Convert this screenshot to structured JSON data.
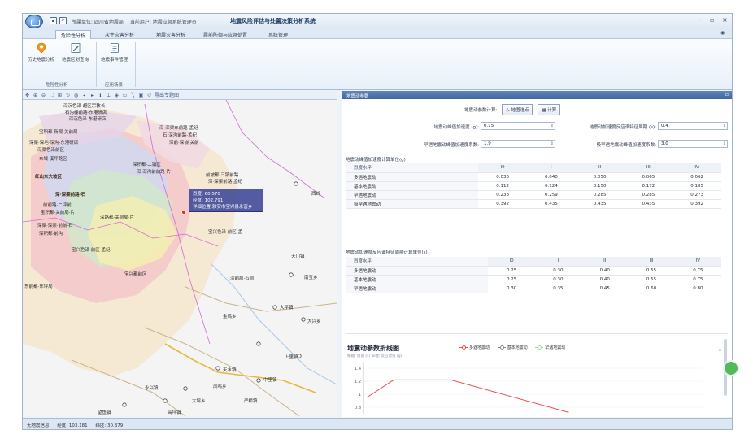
{
  "window": {
    "title_parts": [
      "所属单位: 四川省地震局",
      "当前用户: 地震应急系统管理员"
    ],
    "app_title": "地震风险评估与处置决策分析系统",
    "controls": [
      "–",
      "▫",
      "×"
    ]
  },
  "ribbon": {
    "tabs": [
      "危险性分析",
      "次生灾害分析",
      "地震灾害分析",
      "震前防御与应急处置",
      "系统管理"
    ],
    "active_tab": 0,
    "buttons": [
      {
        "label": "历史地震分析",
        "icon": "location-pin-icon"
      },
      {
        "label": "地震区划查询",
        "icon": "map-edit-icon"
      },
      {
        "label": "地震事件管理",
        "icon": "document-list-icon"
      }
    ],
    "groups": [
      "危险性分析",
      "应用场景"
    ]
  },
  "map": {
    "toolbar_export": "导出专题图",
    "tooltip": {
      "line1": "烈度: 60.570",
      "line2": "经度: 102.791",
      "line3": "详细位置:雅安市宝兴县永富乡"
    },
    "zone_labels": [
      {
        "text": "深沉色泽·超区宗教长"
      },
      {
        "text": "石沟棚前路·东港研店"
      },
      {
        "text": "·深沉色泽·东港研店"
      },
      {
        "text": "宝积都·新观·关前局"
      },
      {
        "text": "深渠·深地·深沟·东港研店"
      },
      {
        "text": "深渠色泽前区"
      },
      {
        "text": "东域·溪坪路区"
      },
      {
        "text": "红山东大坡区"
      },
      {
        "text": "深·深渠东前路·孟纪"
      },
      {
        "text": "石·深沟前路·孟纪"
      },
      {
        "text": "深前·深·前关前"
      },
      {
        "text": "深积都·二镇区"
      },
      {
        "text": "深·深沟前前路·片"
      },
      {
        "text": "前坡都·三镇前路"
      },
      {
        "text": "深·深渠前路·孟纪"
      },
      {
        "text": "深·深渠前路·石"
      },
      {
        "text": "前前路·二坪前"
      },
      {
        "text": "宝积都·关前局·片"
      },
      {
        "text": "深路都·关前局·片"
      },
      {
        "text": "深渠·深渠·前前·石"
      },
      {
        "text": "深积都·前沟"
      },
      {
        "text": "宝兴色泽·前区·孟"
      },
      {
        "text": "宝兴色泽·前区·孟纪"
      },
      {
        "text": "宝兴都前区"
      },
      {
        "text": "东前都·东坪局"
      },
      {
        "text": "深前局·石前"
      },
      {
        "text": "西岭"
      },
      {
        "text": "天川镇"
      },
      {
        "text": "南宝乡"
      },
      {
        "text": "大平镇"
      },
      {
        "text": "上里镇"
      },
      {
        "text": "中里镇"
      },
      {
        "text": "大兴乡"
      },
      {
        "text": "金鸡乡"
      },
      {
        "text": "天水镇"
      },
      {
        "text": "大坪乡"
      },
      {
        "text": "永兴镇"
      },
      {
        "text": "高坪镇"
      },
      {
        "text": "望鱼镇"
      },
      {
        "text": "凤鸣乡"
      },
      {
        "text": "严桥镇"
      }
    ]
  },
  "status": {
    "label": "无地震信息",
    "lon": "经度: 103.181",
    "lat": "纬度: 30.379"
  },
  "panel": {
    "title": "地震动参数",
    "calc_label": "地震动参数计算:",
    "btn_pick": "地图选点",
    "btn_calc": "计算",
    "fields": [
      {
        "label": "地震动峰值加速度 (g):",
        "value": "0.15"
      },
      {
        "label": "地震动加速度反应谱特征周期 (s):",
        "value": "0.4"
      },
      {
        "label": "罕遇地震动峰值加速度系数:",
        "value": "1.9"
      },
      {
        "label": "极罕遇地震动峰值加速度系数:",
        "value": "3.0"
      }
    ],
    "table1_title": "地震动峰值加速度计算单位(g)",
    "table1": {
      "headers": [
        "烈度水平",
        "I0",
        "I",
        "II",
        "III",
        "IV"
      ],
      "rows": [
        [
          "多遇地震动",
          "0.036",
          "0.040",
          "0.050",
          "0.065",
          "0.062"
        ],
        [
          "基本地震动",
          "0.112",
          "0.124",
          "0.150",
          "0.172",
          "0.185"
        ],
        [
          "罕遇地震动",
          "0.238",
          "0.259",
          "0.285",
          "0.285",
          "0.273"
        ],
        [
          "极罕遇地震动",
          "0.392",
          "0.435",
          "0.435",
          "0.435",
          "0.392"
        ]
      ]
    },
    "table2_title": "地震动加速度反应谱特征周期计算单位(s)",
    "table2": {
      "headers": [
        "烈度水平",
        "I0",
        "I",
        "II",
        "III",
        "IV"
      ],
      "rows": [
        [
          "多遇地震动",
          "0.25",
          "0.30",
          "0.40",
          "0.55",
          "0.75"
        ],
        [
          "基本地震动",
          "0.25",
          "0.30",
          "0.40",
          "0.55",
          "0.75"
        ],
        [
          "罕遇地震动",
          "0.30",
          "0.35",
          "0.45",
          "0.60",
          "0.80"
        ]
      ]
    }
  },
  "colors": {
    "accent": "#3f679e",
    "s1": "#e0524f",
    "s2": "#7b8799",
    "s3": "#9fd6a8"
  },
  "chart_data": {
    "type": "line",
    "title": "地震动参数折线图",
    "subtitle": "横轴: 周期 (s) 纵轴: 反应谱值 (g)",
    "series": [
      {
        "name": "多遇地震动",
        "color": "#e0524f"
      },
      {
        "name": "基本地震动",
        "color": "#7b8799"
      },
      {
        "name": "罕遇地震动",
        "color": "#9fd6a8"
      }
    ],
    "y_ticks": [
      "1.4",
      "1.2",
      "1",
      "0.8"
    ],
    "ylim": [
      0.7,
      1.45
    ],
    "line": {
      "x": [
        0,
        0.08,
        0.25,
        0.6
      ],
      "y": [
        0.95,
        1.22,
        1.22,
        0.72
      ]
    }
  }
}
